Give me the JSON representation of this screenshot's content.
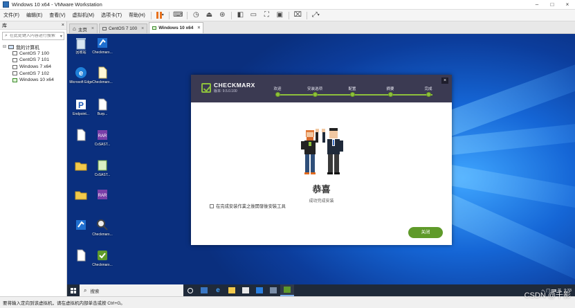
{
  "window": {
    "title": "Windows 10 x64 - VMware Workstation",
    "buttons": [
      "–",
      "□",
      "×"
    ]
  },
  "menubar": {
    "items": [
      "文件(F)",
      "编辑(E)",
      "查看(V)",
      "虚拟机(M)",
      "选项卡(T)",
      "帮助(H)"
    ]
  },
  "library": {
    "title": "库",
    "close": "×",
    "search_placeholder": "在此处键入内容进行搜索",
    "tree_root": "我的计算机",
    "vms": [
      "CentOS 7 100",
      "CentOS 7 101",
      "Windows 7 x64",
      "CentOS 7 102",
      "Windows 10 x64"
    ]
  },
  "tabs": [
    {
      "label": "主页",
      "close": "×"
    },
    {
      "label": "CentOS 7 100",
      "close": "×"
    },
    {
      "label": "Windows 10 x64",
      "close": "×"
    }
  ],
  "desktop_icons": [
    {
      "label": "回收站",
      "icon": "recycle-bin"
    },
    {
      "label": "Checkmarx...",
      "icon": "zip-archive"
    },
    {
      "label": "Microsoft Edge",
      "icon": "edge"
    },
    {
      "label": "Checkmarx...",
      "icon": "document"
    },
    {
      "label": "Endpoint...",
      "icon": "app-p"
    },
    {
      "label": "Burp...",
      "icon": "document"
    },
    {
      "label": "",
      "icon": "document"
    },
    {
      "label": "CxSAST...",
      "icon": "rar-archive"
    },
    {
      "label": "",
      "icon": "folder"
    },
    {
      "label": "CxSAST...",
      "icon": "installer"
    },
    {
      "label": "",
      "icon": "folder"
    },
    {
      "label": "",
      "icon": "rar-archive"
    },
    {
      "label": "",
      "icon": "zip-archive"
    },
    {
      "label": "Checkmarx...",
      "icon": "magnifier"
    },
    {
      "label": "",
      "icon": "document"
    },
    {
      "label": "Checkmarx...",
      "icon": "checkmarx-app"
    }
  ],
  "installer": {
    "brand": "CHECKMARX",
    "version": "版本: 9.5.0.100",
    "close": "×",
    "steps": [
      "欢迎",
      "安装选项",
      "配置",
      "摘要",
      "完成"
    ],
    "congrats": "恭喜",
    "subtitle": "成功完成安装",
    "checkbox_label": "在完成安装作業之後開發後安裝工具",
    "close_button": "关闭"
  },
  "taskbar": {
    "search_placeholder": "搜索",
    "tray_text": "へ 门 ⌨ 英",
    "time": "9:33",
    "date": ""
  },
  "statusbar": {
    "text": "要将输入定向到该虚拟机，请在虚拟机内部单击或按 Ctrl+G。"
  },
  "watermark": "CSDN @千影",
  "colors": {
    "accent_green": "#8ec13c",
    "header_dark": "#3b3a52",
    "close_btn": "#5f9a2a",
    "desktop_blue": "#1566d6"
  }
}
